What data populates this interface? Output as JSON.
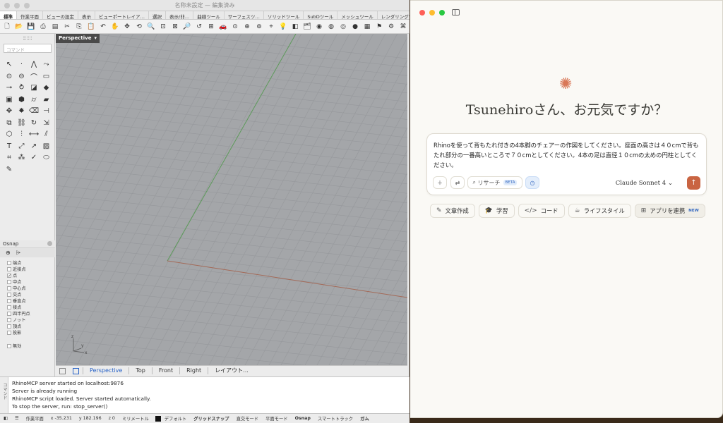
{
  "rhino": {
    "title": "名称未設定 — 編集済み",
    "tabs": [
      "標準",
      "作業平面",
      "ビューの設定",
      "表示",
      "ビューポートレイア…",
      "選択",
      "表示/非…",
      "曲線ツール",
      "サーフェスツ…",
      "ソリッドツール",
      "SubDツール",
      "メッシュツール",
      "レンダリングツール",
      "製図"
    ],
    "command_placeholder": "コマンド",
    "viewport_label": "Perspective",
    "osnap": {
      "title": "Osnap",
      "items": [
        {
          "label": "端点",
          "checked": false
        },
        {
          "label": "近接点",
          "checked": false
        },
        {
          "label": "点",
          "checked": true
        },
        {
          "label": "中点",
          "checked": false
        },
        {
          "label": "中心点",
          "checked": false
        },
        {
          "label": "交点",
          "checked": false
        },
        {
          "label": "垂直点",
          "checked": false
        },
        {
          "label": "接点",
          "checked": false
        },
        {
          "label": "四半円点",
          "checked": false
        },
        {
          "label": "ノット",
          "checked": false
        },
        {
          "label": "頂点",
          "checked": false
        },
        {
          "label": "投影",
          "checked": false
        }
      ],
      "disable": "無効"
    },
    "view_tabs": [
      "Perspective",
      "Top",
      "Front",
      "Right",
      "レイアウト..."
    ],
    "history_side": "コマンド",
    "history": [
      "RhinoMCP server started on localhost:9876",
      "Server is already running",
      "RhinoMCP script loaded. Server started automatically.",
      "To stop the server, run: stop_server()"
    ],
    "status": {
      "cplane": "作業平面",
      "x": "x -35.231",
      "y": "y 182.196",
      "z": "z 0",
      "units": "ミリメートル",
      "layer": "デフォルト",
      "grid_snap": "グリッドスナップ",
      "ortho": "直交モード",
      "planar": "平面モード",
      "osnap": "Osnap",
      "smarttrack": "スマートトラック",
      "gumball": "ガム"
    },
    "axis_labels": [
      "z",
      "y",
      "x"
    ]
  },
  "claude": {
    "greeting": "Tsunehiroさん、お元気ですか？",
    "prompt": "Rhinoを使って背もたれ付きの4本脚のチェアーの作図をしてください。座面の高さは４０cmで背もたれ部分の一番高いところで７０cmとしてください。4本の足は直径１０cmの太めの円柱としてください。",
    "research": "リサーチ",
    "beta": "BETA",
    "model": "Claude Sonnet 4",
    "chips": [
      "文章作成",
      "学習",
      "コード",
      "ライフスタイル",
      "アプリを連携"
    ],
    "new_badge": "NEW",
    "colors": {
      "accent": "#c96442",
      "spark": "#d97757"
    }
  }
}
